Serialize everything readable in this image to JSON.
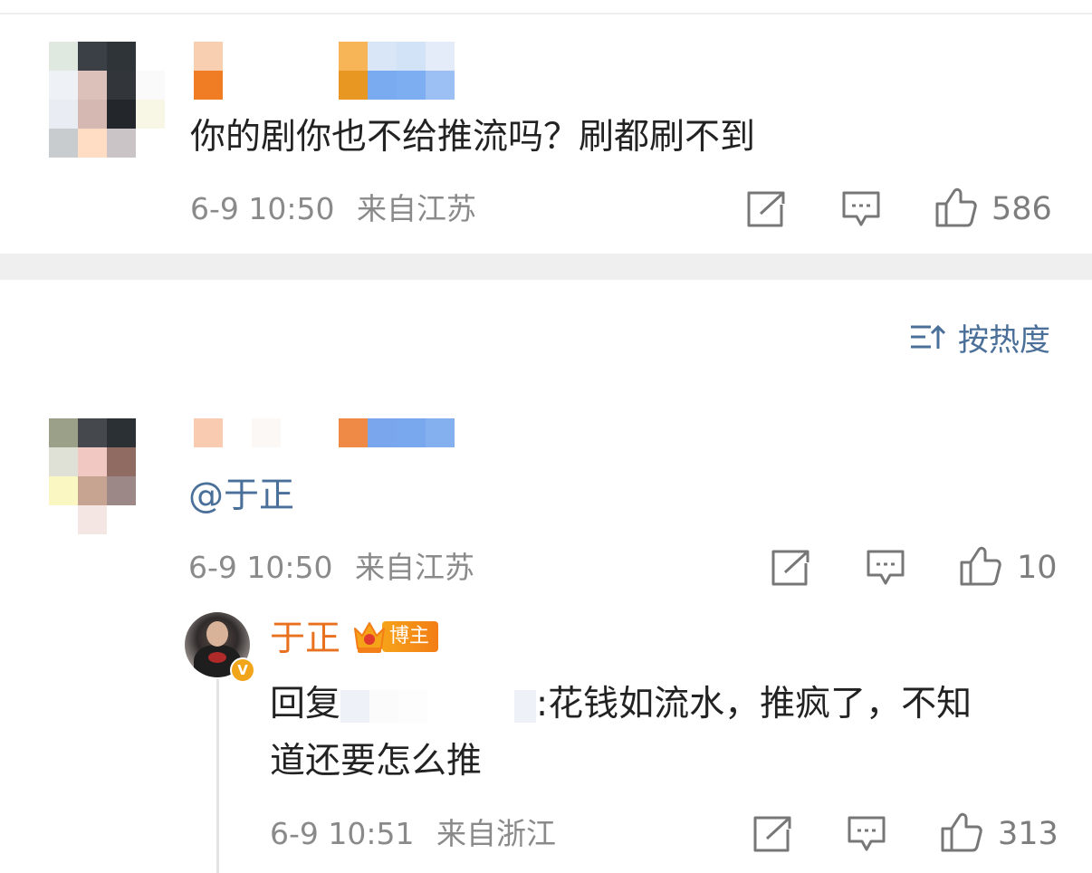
{
  "comment1": {
    "text": "你的剧你也不给推流吗？刷都刷不到",
    "time": "6-9 10:50",
    "location": "来自江苏",
    "likes": "586"
  },
  "sort": {
    "label": "按热度"
  },
  "comment2": {
    "mention": "@于正",
    "time": "6-9 10:50",
    "location": "来自江苏",
    "likes": "10"
  },
  "reply": {
    "author": "于正",
    "badge": "博主",
    "prefix": "回复",
    "text_line1": ":花钱如流水，推疯了，不知",
    "text_line2": "道还要怎么推",
    "time": "6-9 10:51",
    "location": "来自浙江",
    "likes": "313"
  },
  "icons": {
    "repost": "repost-icon",
    "comment": "comment-icon",
    "like": "thumbs-up-icon",
    "sort": "sort-icon",
    "verified": "verified-badge-icon",
    "crown": "crown-icon"
  },
  "colors": {
    "link_blue": "#4a6f99",
    "blogger_orange": "#e8711f",
    "meta_gray": "#8a8a8a",
    "badge_orange": "#f6a319"
  }
}
